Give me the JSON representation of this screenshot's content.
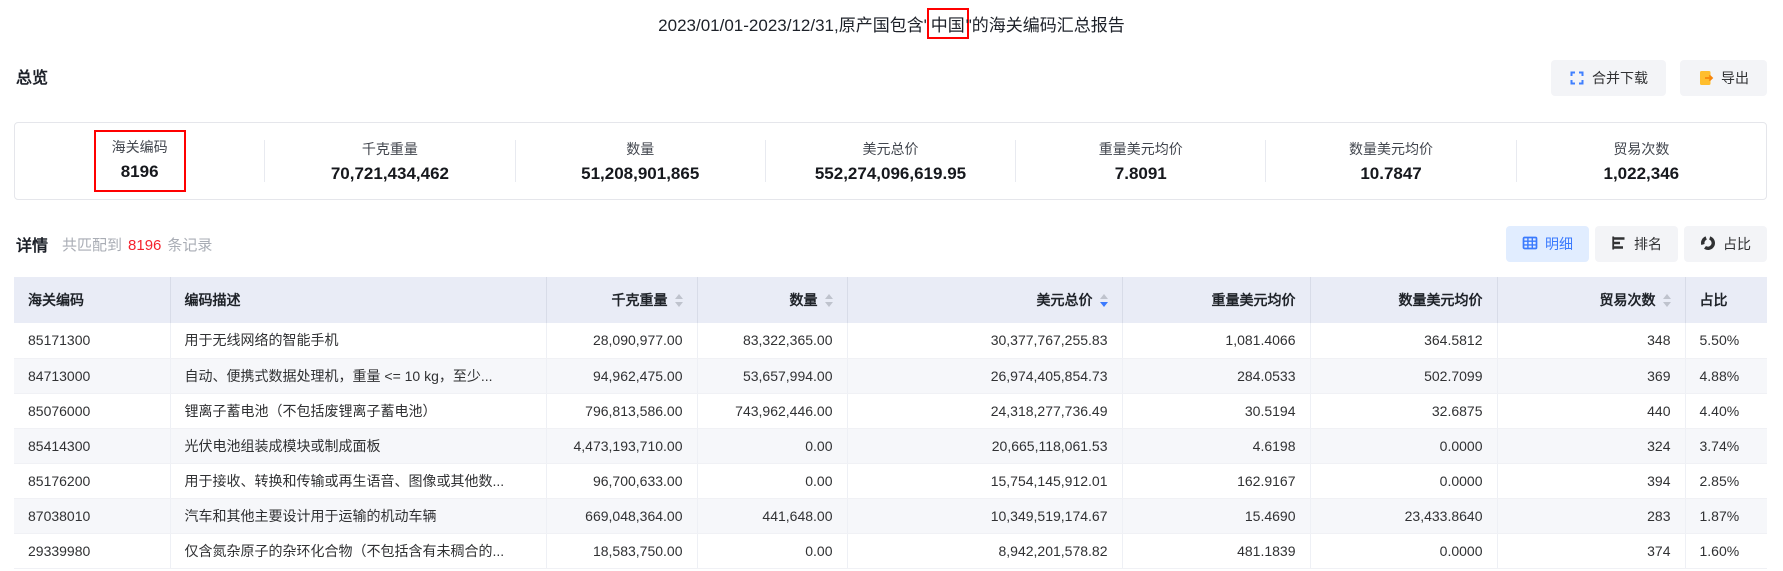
{
  "title": {
    "prefix": "2023/01/01-2023/12/31,原产国包含\"",
    "highlight": "中国",
    "suffix": "\"的海关编码汇总报告"
  },
  "toolbar": {
    "merge_download_label": "合并下载",
    "export_label": "导出"
  },
  "overview": {
    "heading": "总览",
    "stats": [
      {
        "label": "海关编码",
        "value": "8196",
        "highlighted": true
      },
      {
        "label": "千克重量",
        "value": "70,721,434,462"
      },
      {
        "label": "数量",
        "value": "51,208,901,865"
      },
      {
        "label": "美元总价",
        "value": "552,274,096,619.95"
      },
      {
        "label": "重量美元均价",
        "value": "7.8091"
      },
      {
        "label": "数量美元均价",
        "value": "10.7847"
      },
      {
        "label": "贸易次数",
        "value": "1,022,346"
      }
    ]
  },
  "detail": {
    "heading": "详情",
    "match_prefix": "共匹配到",
    "match_count": "8196",
    "match_suffix": "条记录",
    "views": [
      {
        "label": "明细",
        "icon": "table-icon",
        "active": true
      },
      {
        "label": "排名",
        "icon": "ranking-icon",
        "active": false
      },
      {
        "label": "占比",
        "icon": "pie-icon",
        "active": false
      }
    ]
  },
  "table": {
    "columns": [
      {
        "label": "海关编码",
        "align": "left",
        "sortable": false,
        "sort": null
      },
      {
        "label": "编码描述",
        "align": "left",
        "sortable": false,
        "sort": null
      },
      {
        "label": "千克重量",
        "align": "right",
        "sortable": true,
        "sort": null
      },
      {
        "label": "数量",
        "align": "right",
        "sortable": true,
        "sort": null
      },
      {
        "label": "美元总价",
        "align": "right",
        "sortable": true,
        "sort": "desc"
      },
      {
        "label": "重量美元均价",
        "align": "right",
        "sortable": false,
        "sort": null
      },
      {
        "label": "数量美元均价",
        "align": "right",
        "sortable": false,
        "sort": null
      },
      {
        "label": "贸易次数",
        "align": "right",
        "sortable": true,
        "sort": null
      },
      {
        "label": "占比",
        "align": "left",
        "sortable": false,
        "sort": null
      }
    ],
    "rows": [
      [
        "85171300",
        "用于无线网络的智能手机",
        "28,090,977.00",
        "83,322,365.00",
        "30,377,767,255.83",
        "1,081.4066",
        "364.5812",
        "348",
        "5.50%"
      ],
      [
        "84713000",
        "自动、便携式数据处理机，重量 <= 10 kg，至少...",
        "94,962,475.00",
        "53,657,994.00",
        "26,974,405,854.73",
        "284.0533",
        "502.7099",
        "369",
        "4.88%"
      ],
      [
        "85076000",
        "锂离子蓄电池（不包括废锂离子蓄电池）",
        "796,813,586.00",
        "743,962,446.00",
        "24,318,277,736.49",
        "30.5194",
        "32.6875",
        "440",
        "4.40%"
      ],
      [
        "85414300",
        "光伏电池组装成模块或制成面板",
        "4,473,193,710.00",
        "0.00",
        "20,665,118,061.53",
        "4.6198",
        "0.0000",
        "324",
        "3.74%"
      ],
      [
        "85176200",
        "用于接收、转换和传输或再生语音、图像或其他数...",
        "96,700,633.00",
        "0.00",
        "15,754,145,912.01",
        "162.9167",
        "0.0000",
        "394",
        "2.85%"
      ],
      [
        "87038010",
        "汽车和其他主要设计用于运输的机动车辆",
        "669,048,364.00",
        "441,648.00",
        "10,349,519,174.67",
        "15.4690",
        "23,433.8640",
        "283",
        "1.87%"
      ],
      [
        "29339980",
        "仅含氮杂原子的杂环化合物（不包括含有未稠合的...",
        "18,583,750.00",
        "0.00",
        "8,942,201,578.82",
        "481.1839",
        "0.0000",
        "374",
        "1.60%"
      ]
    ]
  },
  "colors": {
    "accent_blue": "#3a7afe",
    "annotation_red": "#ff0000",
    "count_red": "#f5222d",
    "export_orange": "#ffbe2e",
    "header_bg": "#e9ecf6"
  }
}
